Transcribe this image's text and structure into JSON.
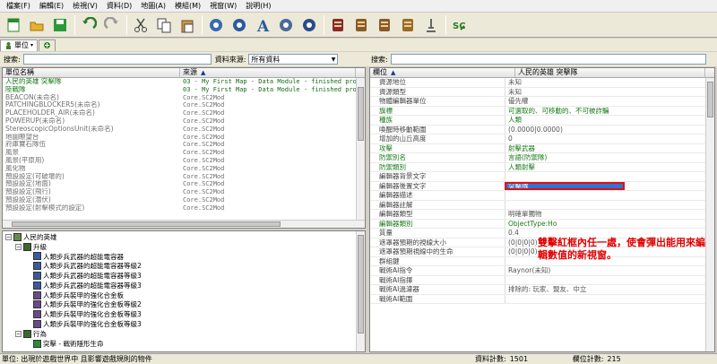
{
  "menubar": [
    "檔案(F)",
    "編輯(E)",
    "檢視(V)",
    "資料(D)",
    "地圖(A)",
    "模組(M)",
    "視窗(W)",
    "說明(H)"
  ],
  "toolbar_icons": [
    "new-file-icon",
    "open-folder-icon",
    "save-icon",
    "undo-icon",
    "redo-icon",
    "cut-icon",
    "copy-icon",
    "paste-icon",
    "terrain-icon",
    "data-editor-icon",
    "text-editor-icon",
    "import-icon",
    "ai-icon",
    "trigger-icon",
    "cutscene-icon",
    "sound-icon",
    "texture-icon",
    "preview-icon",
    "test-map-icon"
  ],
  "tabs": {
    "main": "單位",
    "second": ""
  },
  "search_left": {
    "label": "搜索:",
    "source_label": "資料來源:",
    "source_value": "所有資料"
  },
  "search_right": {
    "label": "搜索:"
  },
  "unit_list": {
    "col_name": "單位名稱",
    "col_source": "來源",
    "rows": [
      {
        "name": "人民的英雄 突擊隊",
        "source": "03 - My First Map - Data Module - finished prod",
        "green": true
      },
      {
        "name": "陸戰隊",
        "source": "03 - My First Map - Data Module - finished prod",
        "green": true
      },
      {
        "name": "BEACON(未命名)",
        "source": "Core.SC2Mod"
      },
      {
        "name": "PATCHINGBLOCKER5(未命名)",
        "source": "Core.SC2Mod"
      },
      {
        "name": "PLACEHOLDER_AIR(未命名)",
        "source": "Core.SC2Mod"
      },
      {
        "name": "POWERUP(未命名)",
        "source": "Core.SC2Mod"
      },
      {
        "name": "StereoscopicOptionsUnit(未命名)",
        "source": "Core.SC2Mod"
      },
      {
        "name": "地圖瞭望台",
        "source": "Core.SC2Mod"
      },
      {
        "name": "府庫寶石隊伍",
        "source": "Core.SC2Mod"
      },
      {
        "name": "風景",
        "source": "Core.SC2Mod"
      },
      {
        "name": "風景(平原用)",
        "source": "Core.SC2Mod"
      },
      {
        "name": "風化物",
        "source": "Core.SC2Mod"
      },
      {
        "name": "預設設定(可破壞的)",
        "source": "Core.SC2Mod"
      },
      {
        "name": "預設設定(地面)",
        "source": "Core.SC2Mod"
      },
      {
        "name": "預設設定(飛行)",
        "source": "Core.SC2Mod"
      },
      {
        "name": "預設設定(潛伏)",
        "source": "Core.SC2Mod"
      },
      {
        "name": "預設設定(射擊模式的設定)",
        "source": "Core.SC2Mod"
      }
    ]
  },
  "tree": {
    "root": "人民的英雄",
    "group1": "升級",
    "items": [
      "人類步兵武器的超能電容器",
      "人類步兵武器的超能電容器等級2",
      "人類步兵武器的超能電容器等級3",
      "人類步兵武器的超能電容器等級3",
      "人類步兵裝甲的強化合金板",
      "人類步兵裝甲的強化合金板等級2",
      "人類步兵裝甲的強化合金板等級3",
      "人類步兵裝甲的強化合金板等級3"
    ],
    "group2": "行為",
    "behavior": "突擊 - 戰術隱形生命"
  },
  "properties": {
    "col_name": "欄位",
    "col_value": "人民的英雄 突擊隊",
    "rows": [
      {
        "name": "資源地位",
        "value": "未知"
      },
      {
        "name": "資源類型",
        "value": "未知"
      },
      {
        "name": "物體編輯器單位",
        "value": "優先權"
      },
      {
        "name": "旗標",
        "value": "可選取的、可移動的、不可被詐騙",
        "green": true
      },
      {
        "name": "種族",
        "value": "人類",
        "green": true
      },
      {
        "name": "喚醒時移動範圍",
        "value": "(0.0000|0.0000)"
      },
      {
        "name": "增加的山丘高度",
        "value": "0"
      },
      {
        "name": "攻擊",
        "value": "射擊武器",
        "green": true
      },
      {
        "name": "防禦別名",
        "value": "言語(防禦隊)",
        "green": true
      },
      {
        "name": "防禦類別",
        "value": "人類射擊",
        "green": true
      },
      {
        "name": "編輯器背景文字",
        "value": ""
      },
      {
        "name": "編輯器後置文字",
        "value": "突擊隊",
        "selected": true
      },
      {
        "name": "編輯器描述",
        "value": ""
      },
      {
        "name": "編輯器註解",
        "value": ""
      },
      {
        "name": "編輯器類型",
        "value": "明確單獨物"
      },
      {
        "name": "編輯器類別",
        "value": "ObjectType:Ho",
        "green": true
      },
      {
        "name": "質量",
        "value": "0.4"
      },
      {
        "name": "遮罩器預期的視線大小",
        "value": "(0|0|0|0)"
      },
      {
        "name": "遮罩器預期視線中的生命",
        "value": "(0|0|0|0)"
      },
      {
        "name": "群組鍵",
        "value": ""
      },
      {
        "name": "戰術AI指令",
        "value": "Raynor(未知)"
      },
      {
        "name": "戰術AI指揮",
        "value": ""
      },
      {
        "name": "戰術AI過濾器",
        "value": "排除的: 玩家、盟友、中立"
      },
      {
        "name": "戰術AI範圍",
        "value": ""
      }
    ]
  },
  "annotation": "雙擊紅框內任一處，使會彈出能用來編輯數值的新視窗。",
  "status": {
    "left": "單位: 出現於遊戲世界中 且影響遊戲規則的物件",
    "count_label": "資料計數:",
    "count": "1501",
    "field_label": "欄位計數:",
    "field_count": "215"
  }
}
